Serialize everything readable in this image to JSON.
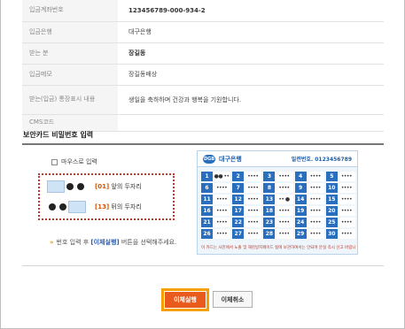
{
  "transfer_info": {
    "rows": [
      {
        "label": "입금계좌번호",
        "value": "123456789-000-934-2"
      },
      {
        "label": "입금은행",
        "value": "대구은행"
      },
      {
        "label": "받는 분",
        "value": "장길동"
      },
      {
        "label": "입금메모",
        "value": "장길동배상"
      },
      {
        "label": "받는(입금) 통장표시 내용",
        "value": "생일을 축하하며 건강과 행복을 기원합니다."
      },
      {
        "label": "CMS코드",
        "value": ""
      }
    ]
  },
  "security": {
    "title": "보안카드 비밀번호 입력",
    "mouse_input_label": "마우스로 입력",
    "row1": {
      "number": "[01]",
      "suffix": "앞의 두자리"
    },
    "row2": {
      "number": "[13]",
      "suffix": "뒤의 두자리"
    },
    "hint_prefix": "번호 입력 후",
    "hint_emphasis": "[이체실행]",
    "hint_suffix": "버튼을 선택해주세요."
  },
  "card": {
    "bank_name": "대구은행",
    "logo_text": "DGB",
    "serial": "일련번호. 0123456789",
    "cells": [
      [
        "1",
        "●● ••",
        "2",
        "••••",
        "3",
        "••••",
        "4",
        "••••",
        "5",
        "••••"
      ],
      [
        "6",
        "••••",
        "7",
        "••••",
        "8",
        "••••",
        "9",
        "••••",
        "10",
        "••••"
      ],
      [
        "11",
        "••••",
        "12",
        "••••",
        "13",
        "•• ●",
        "14",
        "••••",
        "15",
        "••••"
      ],
      [
        "16",
        "••••",
        "17",
        "••••",
        "18",
        "••••",
        "19",
        "••••",
        "20",
        "••••"
      ],
      [
        "21",
        "••••",
        "22",
        "••••",
        "23",
        "••••",
        "24",
        "••••",
        "25",
        "••••"
      ],
      [
        "26",
        "••••",
        "27",
        "••••",
        "28",
        "••••",
        "29",
        "••••",
        "30",
        "••••"
      ]
    ],
    "note": "이 카드는 사진에서 노출 및 해킹방지페이드 됨에 보관하여서는 안되며 분실 즉시 신고 바랍니다."
  },
  "buttons": {
    "execute": "이체실행",
    "cancel": "이체취소"
  },
  "colors": {
    "execute_bg": "#e95b1c",
    "highlight_border": "#f5a000",
    "card_blue": "#2a6fbd",
    "alert_red": "#c0392b"
  }
}
